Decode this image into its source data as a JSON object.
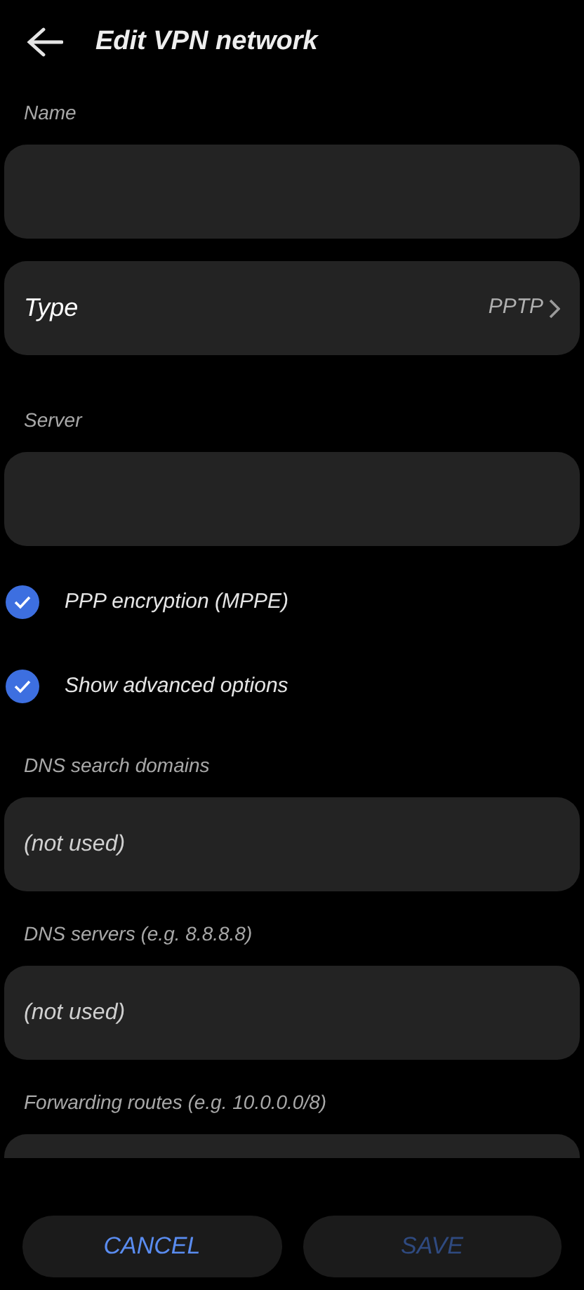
{
  "header": {
    "title": "Edit VPN network"
  },
  "items": [
    {
      "kind": "field",
      "label": "Name"
    },
    {
      "kind": "select",
      "label": "Type",
      "value": "PPTP"
    },
    {
      "kind": "field",
      "label": "Server"
    },
    {
      "kind": "checkbox",
      "label": "PPP encryption (MPPE)",
      "checked": true
    },
    {
      "kind": "checkbox",
      "label": "Show advanced options",
      "checked": true
    },
    {
      "kind": "field",
      "label": "DNS search domains",
      "placeholder": "(not used)"
    },
    {
      "kind": "field",
      "label": "DNS servers (e.g. 8.8.8.8)",
      "placeholder": "(not used)"
    },
    {
      "kind": "field",
      "label": "Forwarding routes (e.g. 10.0.0.0/8)"
    }
  ],
  "buttons": [
    {
      "label": "CANCEL",
      "disabled": false
    },
    {
      "label": "SAVE",
      "disabled": true
    }
  ]
}
